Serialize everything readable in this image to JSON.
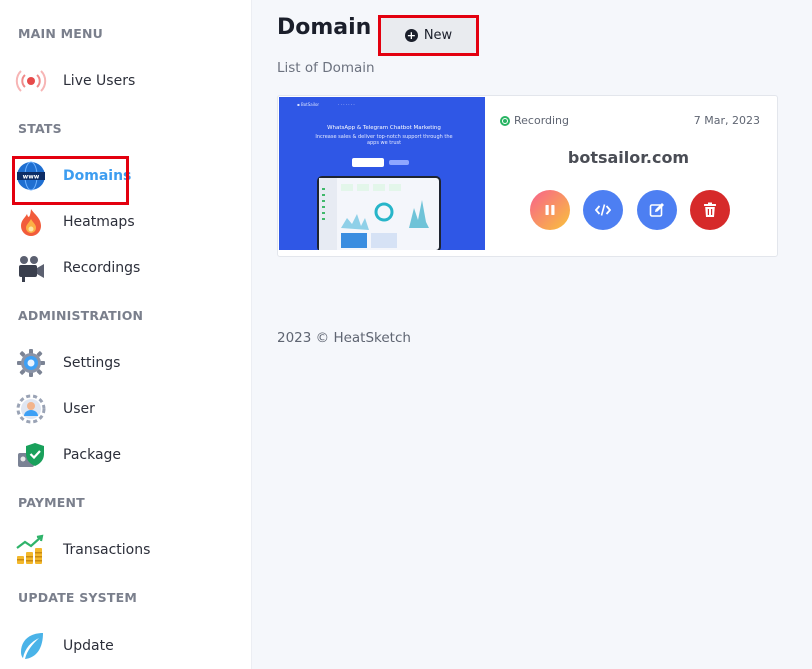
{
  "sidebar": {
    "sections": {
      "main_menu": "MAIN MENU",
      "stats": "STATS",
      "administration": "ADMINISTRATION",
      "payment": "PAYMENT",
      "update_system": "UPDATE SYSTEM"
    },
    "items": {
      "live_users": {
        "label": "Live Users",
        "icon": "broadcast-icon"
      },
      "domains": {
        "label": "Domains",
        "icon": "www-globe-icon",
        "active": true
      },
      "heatmaps": {
        "label": "Heatmaps",
        "icon": "flame-icon"
      },
      "recordings": {
        "label": "Recordings",
        "icon": "video-camera-icon"
      },
      "settings": {
        "label": "Settings",
        "icon": "gear-icon"
      },
      "user": {
        "label": "User",
        "icon": "user-gear-icon"
      },
      "package": {
        "label": "Package",
        "icon": "shield-check-icon"
      },
      "transactions": {
        "label": "Transactions",
        "icon": "coins-chart-icon"
      },
      "update": {
        "label": "Update",
        "icon": "leaf-icon"
      }
    }
  },
  "header": {
    "title": "Domain",
    "new_button": "New",
    "subtitle": "List of Domain"
  },
  "card": {
    "status": "Recording",
    "date": "7 Mar, 2023",
    "domain": "botsailor.com",
    "thumbnail": {
      "heading": "WhatsApp & Telegram Chatbot Marketing",
      "subheading": "Increase sales & deliver top-notch support through the apps we trust"
    }
  },
  "footer": {
    "text": "2023 © HeatSketch"
  },
  "colors": {
    "accent": "#3d9df0",
    "highlight": "#e3000f",
    "recording": "#28b463",
    "delete": "#d62a2a",
    "action_blue": "#4d7ff2"
  }
}
